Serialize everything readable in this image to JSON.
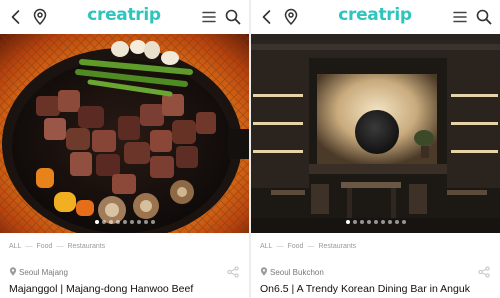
{
  "brand": {
    "logo_text": "creatrip",
    "accent_color": "#2fc4bd"
  },
  "icons": {
    "back": "chevron-left-icon",
    "location": "map-pin-icon",
    "menu": "hamburger-menu-icon",
    "search": "search-icon",
    "share": "share-icon"
  },
  "cards": [
    {
      "image_alt": "Grilled hanwoo beef cubes in a cast iron skillet with asparagus, garlic, mushrooms and peppers",
      "carousel": {
        "total": 9,
        "active": 0
      },
      "breadcrumb": [
        "ALL",
        "Food",
        "Restaurants"
      ],
      "location": "Seoul Majang",
      "title": "Majanggol | Majang-dong Hanwoo Beef"
    },
    {
      "image_alt": "Dimly lit restaurant interior with a round backlit wall panel and dining tables",
      "carousel": {
        "total": 9,
        "active": 0
      },
      "breadcrumb": [
        "ALL",
        "Food",
        "Restaurants"
      ],
      "location": "Seoul Bukchon",
      "title": "On6.5 | A Trendy Korean Dining Bar in Anguk"
    }
  ]
}
